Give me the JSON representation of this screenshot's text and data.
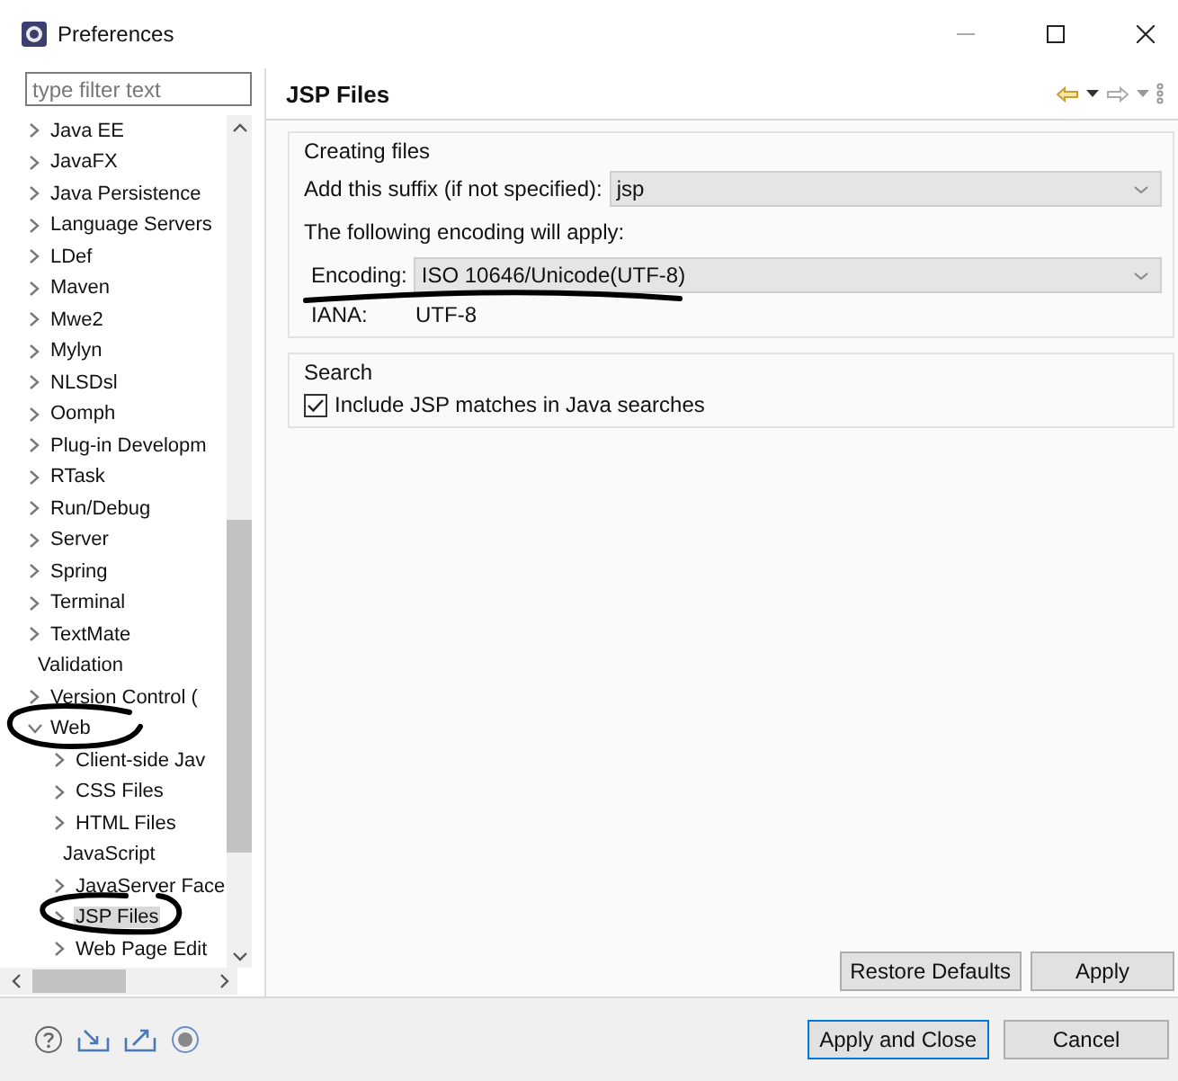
{
  "window": {
    "title": "Preferences"
  },
  "filter": {
    "placeholder": "type filter text"
  },
  "tree": [
    {
      "label": "Java EE",
      "kind": "folder",
      "expanded": false,
      "selected": false
    },
    {
      "label": "JavaFX",
      "kind": "folder",
      "expanded": false,
      "selected": false
    },
    {
      "label": "Java Persistence",
      "kind": "folder",
      "expanded": false,
      "selected": false
    },
    {
      "label": "Language Servers",
      "kind": "folder",
      "expanded": false,
      "selected": false
    },
    {
      "label": "LDef",
      "kind": "folder",
      "expanded": false,
      "selected": false
    },
    {
      "label": "Maven",
      "kind": "folder",
      "expanded": false,
      "selected": false
    },
    {
      "label": "Mwe2",
      "kind": "folder",
      "expanded": false,
      "selected": false
    },
    {
      "label": "Mylyn",
      "kind": "folder",
      "expanded": false,
      "selected": false
    },
    {
      "label": "NLSDsl",
      "kind": "folder",
      "expanded": false,
      "selected": false
    },
    {
      "label": "Oomph",
      "kind": "folder",
      "expanded": false,
      "selected": false
    },
    {
      "label": "Plug-in Developm",
      "kind": "folder",
      "expanded": false,
      "selected": false
    },
    {
      "label": "RTask",
      "kind": "folder",
      "expanded": false,
      "selected": false
    },
    {
      "label": "Run/Debug",
      "kind": "folder",
      "expanded": false,
      "selected": false
    },
    {
      "label": "Server",
      "kind": "folder",
      "expanded": false,
      "selected": false
    },
    {
      "label": "Spring",
      "kind": "folder",
      "expanded": false,
      "selected": false
    },
    {
      "label": "Terminal",
      "kind": "folder",
      "expanded": false,
      "selected": false
    },
    {
      "label": "TextMate",
      "kind": "folder",
      "expanded": false,
      "selected": false
    },
    {
      "label": "Validation",
      "kind": "leaf",
      "selected": false
    },
    {
      "label": "Version Control (",
      "kind": "folder",
      "expanded": false,
      "selected": false
    },
    {
      "label": "Web",
      "kind": "folder",
      "expanded": true,
      "selected": false,
      "children": [
        {
          "label": "Client-side Jav",
          "kind": "folder",
          "expanded": false,
          "selected": false
        },
        {
          "label": "CSS Files",
          "kind": "folder",
          "expanded": false,
          "selected": false
        },
        {
          "label": "HTML Files",
          "kind": "folder",
          "expanded": false,
          "selected": false
        },
        {
          "label": "JavaScript",
          "kind": "leaf",
          "selected": false
        },
        {
          "label": "JavaServer Face",
          "kind": "folder",
          "expanded": false,
          "selected": false
        },
        {
          "label": "JSP Files",
          "kind": "folder",
          "expanded": false,
          "selected": true
        },
        {
          "label": "Web Page Edit",
          "kind": "folder",
          "expanded": false,
          "selected": false
        }
      ]
    }
  ],
  "page": {
    "title": "JSP Files",
    "creating": {
      "legend": "Creating files",
      "suffix_label": "Add this suffix (if not specified):",
      "suffix_value": "jsp",
      "note": "The following encoding will apply:",
      "encoding_label": "Encoding:",
      "encoding_value": "ISO 10646/Unicode(UTF-8)",
      "iana_label": "IANA:",
      "iana_value": "UTF-8"
    },
    "search": {
      "legend": "Search",
      "checkbox": {
        "label": "Include JSP matches in Java searches",
        "checked": true
      }
    },
    "buttons": [
      "Restore Defaults",
      "Apply"
    ]
  },
  "footer_buttons": [
    {
      "label": "Apply and Close",
      "default": true
    },
    {
      "label": "Cancel",
      "default": false
    }
  ],
  "annotations": [
    {
      "kind": "underline"
    },
    {
      "kind": "circle"
    },
    {
      "kind": "circle"
    }
  ]
}
